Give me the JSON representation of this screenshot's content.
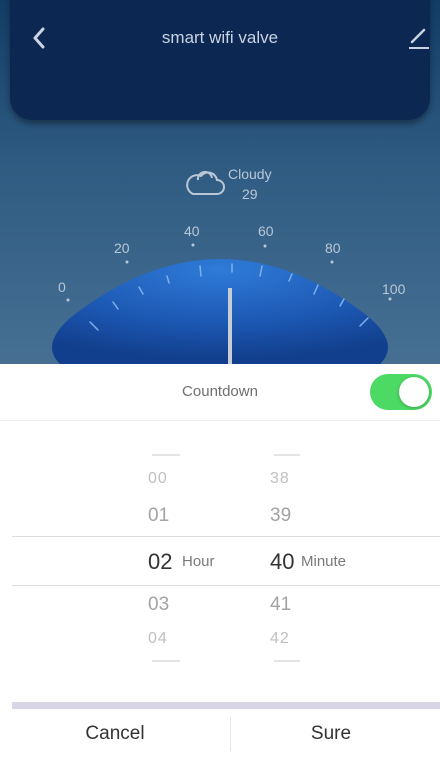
{
  "header": {
    "title": "smart wifi valve"
  },
  "icons": {
    "back": "chevron-left-icon",
    "edit": "pencil-icon",
    "weather": "cloud-icon"
  },
  "weather": {
    "condition": "Cloudy",
    "temperature": "29"
  },
  "dial": {
    "scale_labels": [
      "0",
      "20",
      "40",
      "60",
      "80",
      "100"
    ],
    "needle_value": 50
  },
  "countdown": {
    "label": "Countdown",
    "enabled": true
  },
  "picker": {
    "hours": [
      "00",
      "01",
      "02",
      "03",
      "04"
    ],
    "hour_selected": "02",
    "hour_unit": "Hour",
    "minutes": [
      "38",
      "39",
      "40",
      "41",
      "42"
    ],
    "minute_selected": "40",
    "minute_unit": "Minute"
  },
  "buttons": {
    "cancel": "Cancel",
    "sure": "Sure"
  },
  "colors": {
    "header_bg": "#0b2752",
    "toggle_on": "#4cd964",
    "dial_blue": "#2a6bc7"
  }
}
